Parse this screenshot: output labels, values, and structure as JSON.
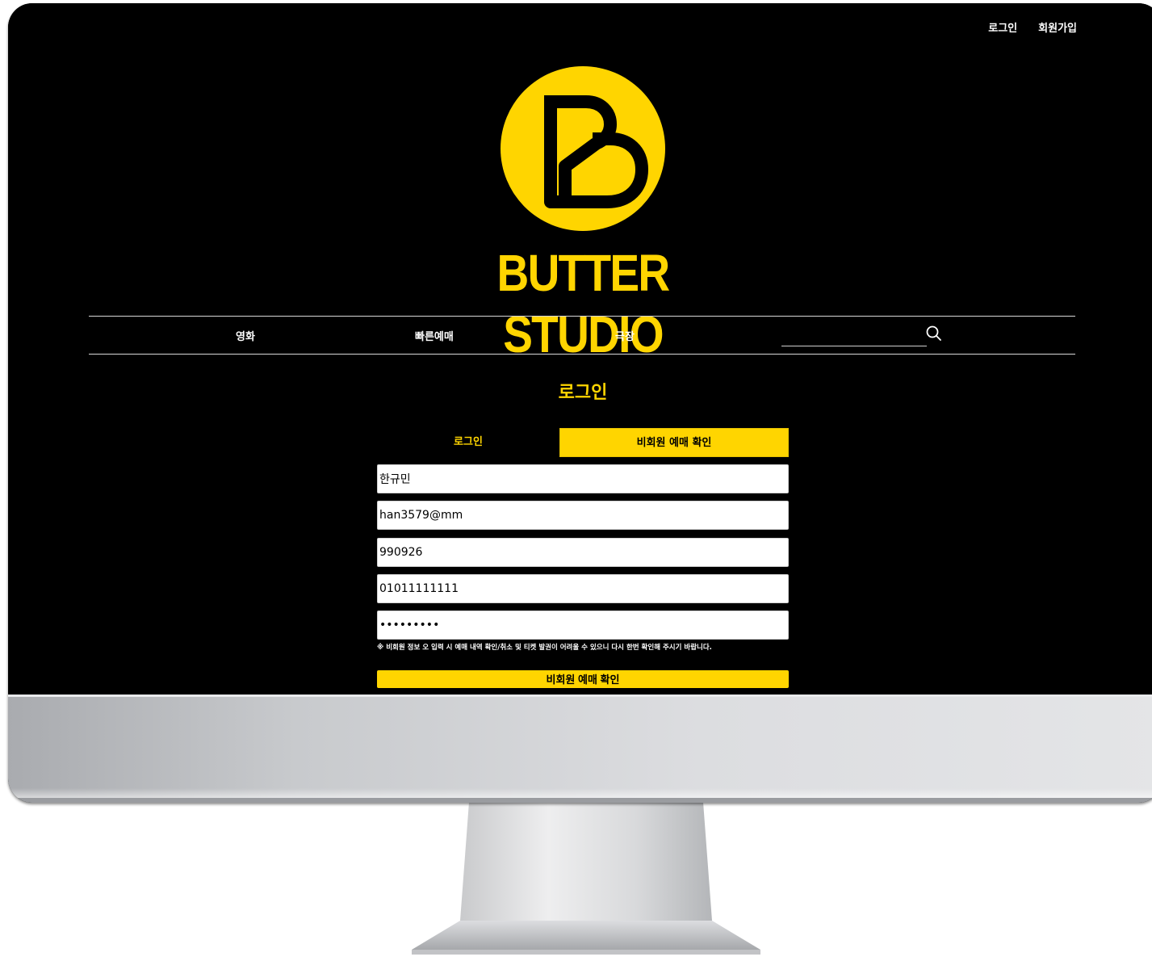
{
  "header": {
    "links": {
      "login": "로그인",
      "signup": "회원가입"
    },
    "brand": "BUTTER STUDIO",
    "logo_icon": "butter-b-logo-icon"
  },
  "nav": {
    "items": [
      {
        "label": "영화"
      },
      {
        "label": "빠른예매"
      },
      {
        "label": "극장"
      }
    ],
    "search": {
      "value": "",
      "icon": "search-icon"
    }
  },
  "page": {
    "title": "로그인",
    "tabs": [
      {
        "label": "로그인",
        "active": false
      },
      {
        "label": "비회원 예매 확인",
        "active": true
      }
    ],
    "form": {
      "name": "한규민",
      "email": "han3579@mm",
      "birth": "990926",
      "phone": "01011111111",
      "password": "123456789"
    },
    "notice": "※ 비회원 정보 오 입력 시 예매 내역 확인/취소 및 티켓 발권이 어려울 수 있으니 다시 한번 확인해 주시기 바랍니다.",
    "submit_label": "비회원 예매 확인"
  },
  "colors": {
    "accent": "#ffd500",
    "background": "#000000",
    "text": "#ffffff"
  }
}
